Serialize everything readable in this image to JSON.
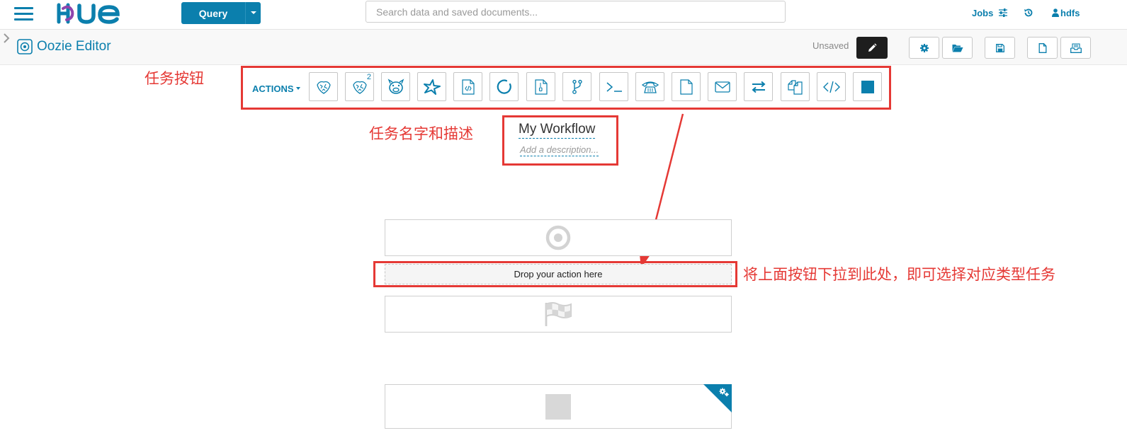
{
  "header": {
    "logo": "HUE",
    "query_label": "Query",
    "search_placeholder": "Search data and saved documents...",
    "jobs_label": "Jobs",
    "user_label": "hdfs"
  },
  "editor": {
    "title": "Oozie Editor",
    "status": "Unsaved"
  },
  "toolbar": {
    "actions_label": "ACTIONS",
    "hive2_superscript": "2",
    "icons": [
      "hive-icon",
      "hive2-icon",
      "pig-icon",
      "spark-icon",
      "java-icon",
      "subworkflow-icon",
      "sqoop-icon",
      "fork-icon",
      "shell-icon",
      "ssh-icon",
      "hdfs-fs-icon",
      "email-icon",
      "streaming-icon",
      "distcp-icon",
      "generic-icon",
      "kill-icon"
    ]
  },
  "workflow": {
    "name": "My Workflow",
    "description_placeholder": "Add a description...",
    "drop_text": "Drop your action here"
  },
  "annotations": {
    "actions_note": "任务按钮",
    "name_note": "任务名字和描述",
    "drop_note": "将上面按钮下拉到此处，即可选择对应类型任务"
  },
  "colors": {
    "brand": "#0B7FAD",
    "annotation_red": "#e53935",
    "edit_button_bg": "#1e1e1e"
  }
}
